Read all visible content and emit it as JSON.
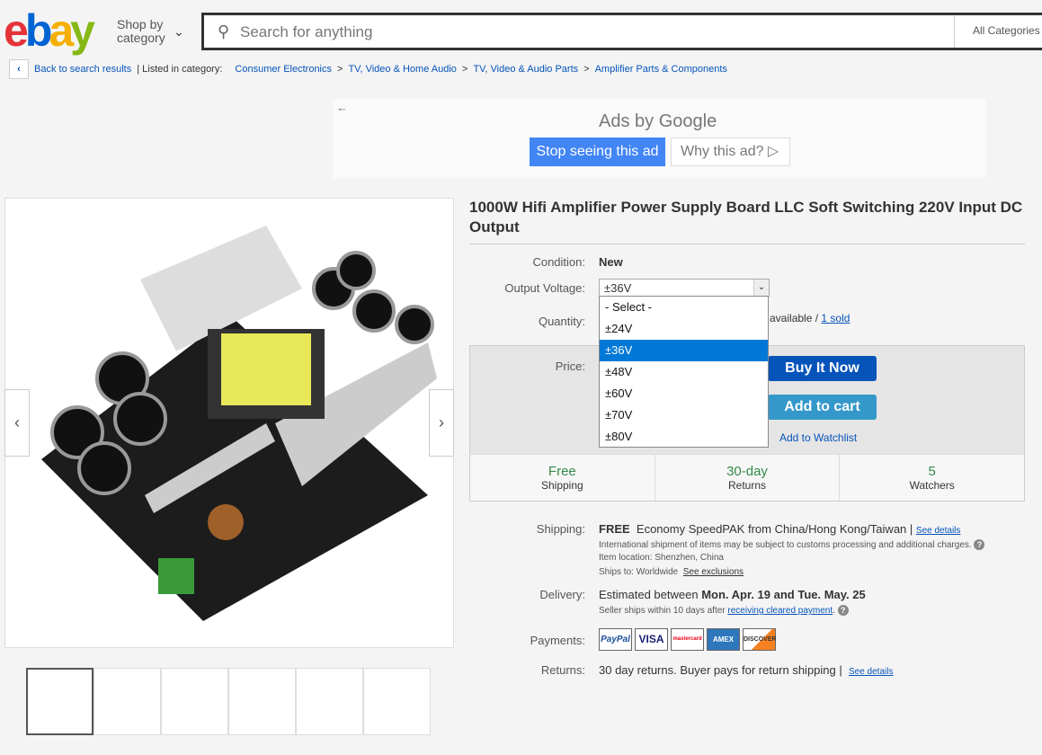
{
  "header": {
    "logo": "ebay",
    "shop_by": "Shop by",
    "category": "category",
    "search_placeholder": "Search for anything",
    "all_categories": "All Categories"
  },
  "breadcrumb": {
    "back": "Back to search results",
    "listed": "| Listed in category:",
    "items": [
      "Consumer Electronics",
      "TV, Video & Home Audio",
      "TV, Video & Audio Parts",
      "Amplifier Parts & Components"
    ],
    "sep": ">"
  },
  "ad": {
    "ads_by": "Ads by Google",
    "stop": "Stop seeing this ad",
    "why": "Why this ad? ▷"
  },
  "item": {
    "title": "1000W Hifi Amplifier Power Supply Board LLC Soft Switching 220V Input DC Output",
    "condition_label": "Condition:",
    "condition": "New",
    "voltage_label": "Output Voltage:",
    "voltage_selected": "±36V",
    "voltage_options": [
      "- Select -",
      "±24V",
      "±36V",
      "±48V",
      "±60V",
      "±70V",
      "±80V"
    ],
    "quantity_label": "Quantity:",
    "available": "0 available /",
    "sold": "1 sold",
    "price_label": "Price:",
    "buy_now": "Buy It Now",
    "add_cart": "Add to cart",
    "watchlist": "Add to Watchlist",
    "cells": [
      {
        "a": "Free",
        "b": "Shipping"
      },
      {
        "a": "30-day",
        "b": "Returns"
      },
      {
        "a": "5",
        "b": "Watchers"
      }
    ]
  },
  "shipping": {
    "label": "Shipping:",
    "free": "FREE",
    "method": "Economy SpeedPAK from China/Hong Kong/Taiwan |",
    "see": "See details",
    "intl": "International shipment of items may be subject to customs processing and additional charges.",
    "loc": "Item location:  Shenzhen, China",
    "ships_to": "Ships to:  Worldwide",
    "excl": "See exclusions"
  },
  "delivery": {
    "label": "Delivery:",
    "pre": "Estimated between",
    "dates": "Mon. Apr. 19 and Tue. May. 25",
    "seller": "Seller ships within 10 days after",
    "link": "receiving cleared payment",
    "dot": "."
  },
  "payments": {
    "label": "Payments:",
    "methods": [
      "PayPal",
      "VISA",
      "mastercard",
      "AMEX",
      "DISCOVER"
    ]
  },
  "returns": {
    "label": "Returns:",
    "text": "30 day returns. Buyer pays for return shipping |",
    "see": "See details"
  },
  "colors": {
    "link": "#0654ba",
    "buy": "#0654ba",
    "cart": "#3498ca",
    "green": "#348a4a",
    "highlight": "#0078d7"
  }
}
